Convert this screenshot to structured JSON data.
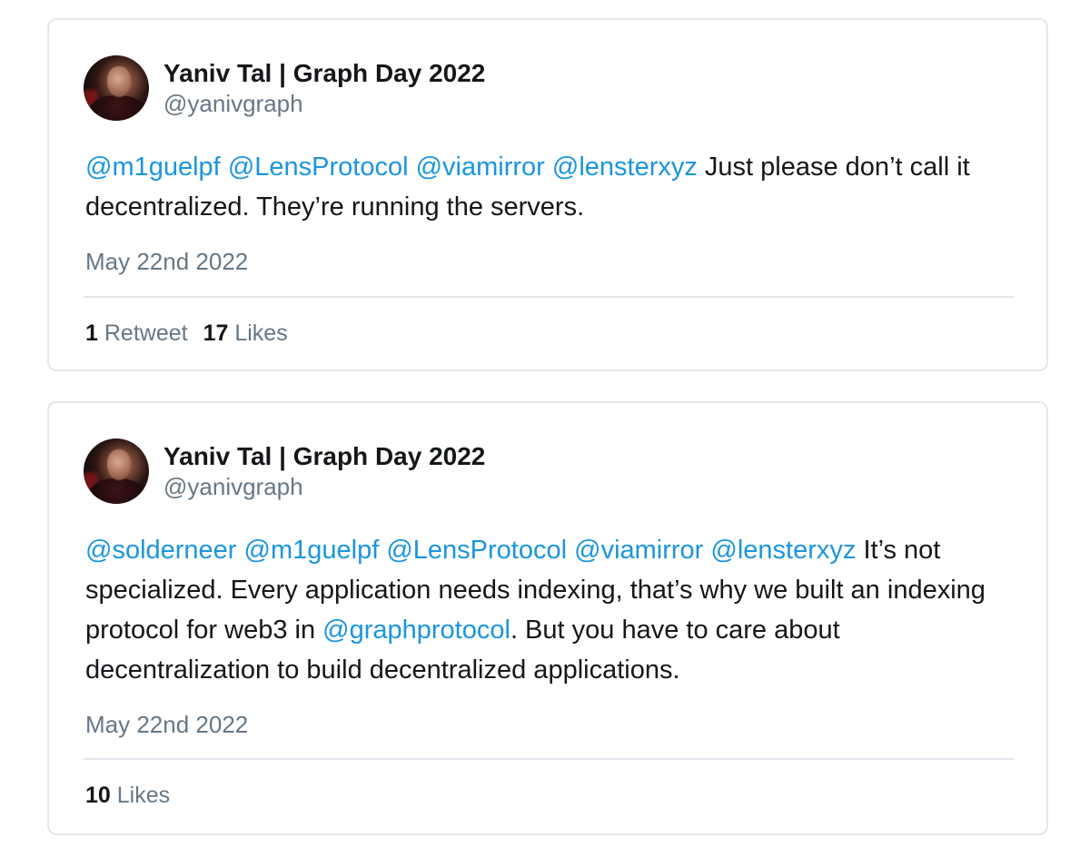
{
  "tweets": [
    {
      "display_name": "Yaniv Tal | Graph Day 2022",
      "handle": "@yanivgraph",
      "mentions": [
        "@m1guelpf",
        "@LensProtocol",
        "@viamirror",
        "@lensterxyz"
      ],
      "text_after_mentions": "Just please don’t call it decentralized. They’re running the servers.",
      "date": "May 22nd 2022",
      "retweets_count": "1",
      "retweets_label": "Retweet",
      "likes_count": "17",
      "likes_label": "Likes"
    },
    {
      "display_name": "Yaniv Tal | Graph Day 2022",
      "handle": "@yanivgraph",
      "mentions": [
        "@solderneer",
        "@m1guelpf",
        "@LensProtocol",
        "@viamirror",
        "@lensterxyz"
      ],
      "text_part_1": "It’s not specialized. Every application needs indexing, that’s why we built an indexing protocol for web3 in",
      "inline_mention": "@graphprotocol",
      "text_part_2": ". But you have to care about decentralization to build decentralized applications.",
      "date": "May 22nd 2022",
      "likes_count": "10",
      "likes_label": "Likes"
    }
  ],
  "colors": {
    "link": "#1b95e0",
    "text": "#14171a",
    "secondary": "#657786",
    "border": "#e1e8ed"
  },
  "icons": {
    "avatar": "profile-photo-avatar"
  }
}
